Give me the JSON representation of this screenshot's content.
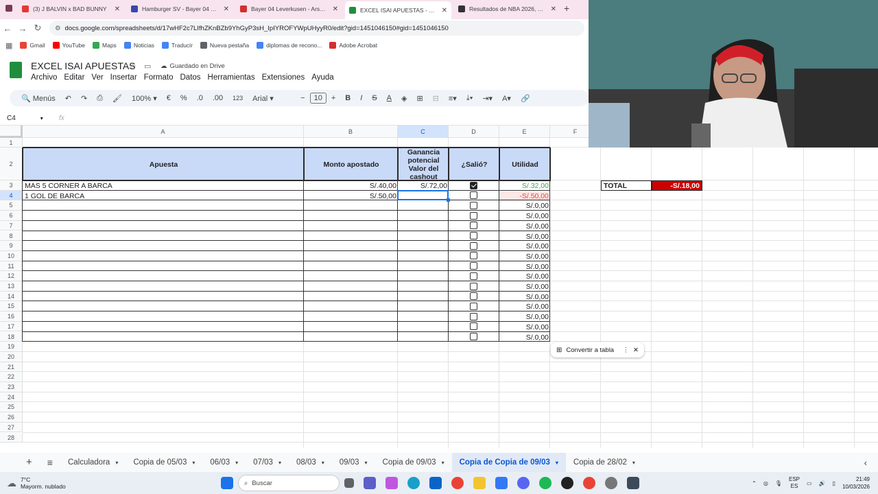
{
  "browser": {
    "tabs": [
      {
        "title": "(3) J BALVIN x BAD BUNNY",
        "color": "#e53935",
        "active": false
      },
      {
        "title": "Hamburger SV - Bayer 04 Leve",
        "color": "#3949ab",
        "active": false
      },
      {
        "title": "Bayer 04 Leverkusen - Arsenal",
        "color": "#d32f2f",
        "active": false
      },
      {
        "title": "EXCEL ISAI APUESTAS - Hojas d",
        "color": "#1e8e3e",
        "active": true
      },
      {
        "title": "Resultados de NBA 2026, Balon",
        "color": "#333333",
        "active": false
      }
    ],
    "new_tab": "+",
    "url": "docs.google.com/spreadsheets/d/17wHF2c7LIfhZKnBZb9YhGyP3sH_IpIYROFYWpUHyyR0/edit?gid=1451046150#gid=1451046150",
    "bookmarks": [
      {
        "label": "Gmail",
        "color": "#ea4335"
      },
      {
        "label": "YouTube",
        "color": "#ff0000"
      },
      {
        "label": "Maps",
        "color": "#34a853"
      },
      {
        "label": "Noticias",
        "color": "#4285f4"
      },
      {
        "label": "Traducir",
        "color": "#4285f4"
      },
      {
        "label": "Nueva pestaña",
        "color": "#5f6368"
      },
      {
        "label": "diplomas de recono...",
        "color": "#4285f4"
      },
      {
        "label": "Adobe Acrobat",
        "color": "#d32f2f"
      }
    ]
  },
  "doc": {
    "title": "EXCEL ISAI APUESTAS",
    "saved": "Guardado en Drive",
    "menus": [
      "Archivo",
      "Editar",
      "Ver",
      "Insertar",
      "Formato",
      "Datos",
      "Herramientas",
      "Extensiones",
      "Ayuda"
    ],
    "toolbar": {
      "search": "Menús",
      "zoom": "100%",
      "euro": "€",
      "percent": "%",
      "dec_down": ".0",
      "dec_up": ".00",
      "num": "123",
      "font": "Arial",
      "font_size": "10",
      "bold": "B",
      "italic": "I"
    },
    "namebox": "C4",
    "fx": "fx"
  },
  "grid": {
    "columns": [
      "A",
      "B",
      "C",
      "D",
      "E",
      "F"
    ],
    "rows": [
      "1",
      "2",
      "3",
      "4",
      "5",
      "6",
      "7",
      "8",
      "9",
      "10",
      "11",
      "12",
      "13",
      "14",
      "15",
      "16",
      "17",
      "18",
      "19",
      "20",
      "21",
      "22",
      "23",
      "24",
      "25",
      "26",
      "27",
      "28"
    ],
    "headers": {
      "a": "Apuesta",
      "b": "Monto apostado",
      "c": "Ganancia potencial Valor del cashout",
      "d": "¿Salió?",
      "e": "Utilidad"
    },
    "data": [
      {
        "a": "MAS 5 CORNER A BARCA",
        "b": "S/.40,00",
        "c": "S/.72,00",
        "d": true,
        "e": "S/.32,00",
        "e_color": "#34a853"
      },
      {
        "a": "1 GOL DE BARCA",
        "b": "S/.50,00",
        "c": "",
        "d": false,
        "e": "-S/.50,00",
        "e_color": "#ea4335"
      },
      {
        "a": "",
        "b": "",
        "c": "",
        "d": false,
        "e": "S/.0,00"
      },
      {
        "a": "",
        "b": "",
        "c": "",
        "d": false,
        "e": "S/.0,00"
      },
      {
        "a": "",
        "b": "",
        "c": "",
        "d": false,
        "e": "S/.0,00"
      },
      {
        "a": "",
        "b": "",
        "c": "",
        "d": false,
        "e": "S/.0,00"
      },
      {
        "a": "",
        "b": "",
        "c": "",
        "d": false,
        "e": "S/.0,00"
      },
      {
        "a": "",
        "b": "",
        "c": "",
        "d": false,
        "e": "S/.0,00"
      },
      {
        "a": "",
        "b": "",
        "c": "",
        "d": false,
        "e": "S/.0,00"
      },
      {
        "a": "",
        "b": "",
        "c": "",
        "d": false,
        "e": "S/.0,00"
      },
      {
        "a": "",
        "b": "",
        "c": "",
        "d": false,
        "e": "S/.0,00"
      },
      {
        "a": "",
        "b": "",
        "c": "",
        "d": false,
        "e": "S/.0,00"
      },
      {
        "a": "",
        "b": "",
        "c": "",
        "d": false,
        "e": "S/.0,00"
      },
      {
        "a": "",
        "b": "",
        "c": "",
        "d": false,
        "e": "S/.0,00"
      },
      {
        "a": "",
        "b": "",
        "c": "",
        "d": false,
        "e": "S/.0,00"
      },
      {
        "a": "",
        "b": "",
        "c": "",
        "d": false,
        "e": "S/.0,00"
      }
    ],
    "total_label": "TOTAL",
    "total_value": "-S/.18,00",
    "convert_chip": "Convertir a tabla"
  },
  "sheets": {
    "tabs": [
      "Calculadora",
      "Copia de 05/03",
      "06/03",
      "07/03",
      "08/03",
      "09/03",
      "Copia de 09/03",
      "Copia de Copia de 09/03",
      "Copia de 28/02"
    ],
    "active": "Copia de Copia de 09/03"
  },
  "taskbar": {
    "weather_temp": "7°C",
    "weather_desc": "Mayorm. nublado",
    "search": "Buscar",
    "lang1": "ESP",
    "lang2": "ES",
    "time": "21:49",
    "date": "10/03/2026"
  },
  "colors": {
    "header_fill": "#c9daf8",
    "total_fill": "#cc0000",
    "active_tab": "#0b57d0"
  }
}
